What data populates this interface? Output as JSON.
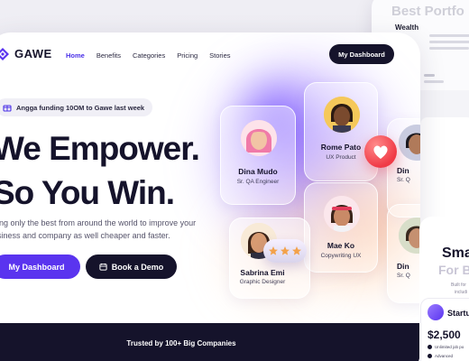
{
  "back_card": {
    "title": "Best Portfo",
    "subtitle": "Wealth"
  },
  "nav": {
    "brand": "GAWE",
    "items": [
      {
        "label": "Home",
        "active": true
      },
      {
        "label": "Benefits",
        "active": false
      },
      {
        "label": "Categories",
        "active": false
      },
      {
        "label": "Pricing",
        "active": false
      },
      {
        "label": "Stories",
        "active": false
      }
    ],
    "dashboard_button": "My Dashboard"
  },
  "announcement": "Angga funding 10OM to Gawe last week",
  "hero": {
    "headline_line1": "We Empower.",
    "headline_line2": "So You Win.",
    "description_line1": "iring only the best from around the world to improve your",
    "description_line2": "usiness and company as well cheaper and faster.",
    "primary_button": "My Dashboard",
    "secondary_button": "Book a Demo"
  },
  "trusted": "Trusted by 100+ Big Companies",
  "profiles": [
    {
      "name": "Dina Mudo",
      "role": "Sr. QA Engineer"
    },
    {
      "name": "Rome Pato",
      "role": "UX Product"
    },
    {
      "name": "Mae Ko",
      "role": "Copywriting UX"
    },
    {
      "name": "Sabrina Emi",
      "role": "Graphic Designer"
    },
    {
      "name": "Din",
      "role": "Sr. Q"
    },
    {
      "name": "Din",
      "role": "Sr. Q"
    }
  ],
  "right_panel": {
    "heading_line1": "Sma",
    "heading_line2": "For B",
    "body_line1": "Built for",
    "body_line2": "includi",
    "plan_name": "Startup",
    "plan_price": "$2,500",
    "features": [
      "Unlimited job po",
      "Advanced"
    ]
  },
  "colors": {
    "brand_purple": "#5a34ef",
    "dark": "#15132b",
    "heart_red": "#f03a46"
  }
}
